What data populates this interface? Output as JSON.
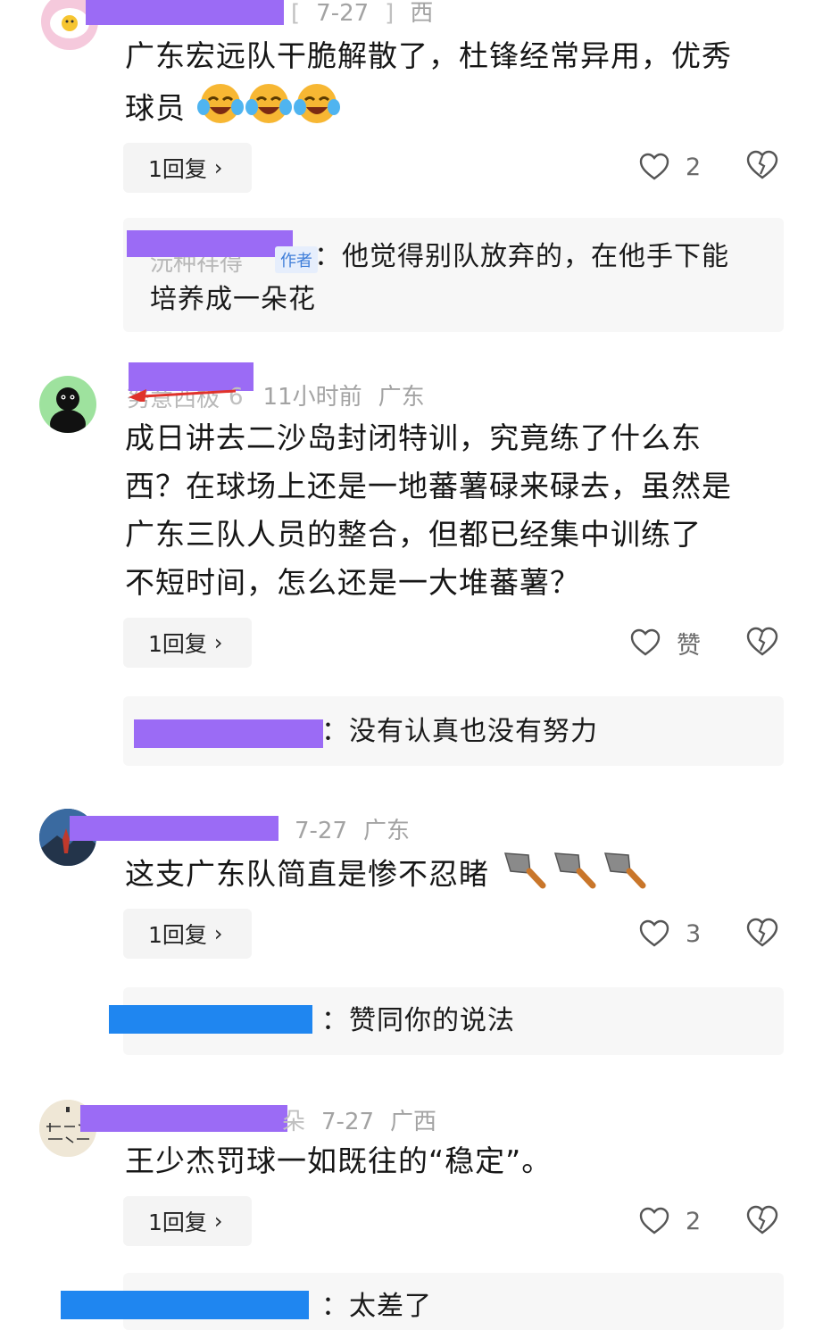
{
  "comments": [
    {
      "meta": {
        "date": "7-27",
        "region": "西"
      },
      "text_line1": "广东宏远队干脆解散了，杜锋经常异用，优秀",
      "text_line2": "球员",
      "emoji": [
        "laughing-crying-emoji",
        "laughing-crying-emoji",
        "laughing-crying-emoji"
      ],
      "reply_label": "1回复",
      "likes": "2",
      "sub_reply": {
        "author_tag": "作者",
        "text_line1": "：他觉得别队放弃的，在他手下能",
        "text_line2": "培养成一朵花"
      }
    },
    {
      "meta": {
        "name_tail": "6",
        "time": "11小时前",
        "region": "广东"
      },
      "text": [
        "成日讲去二沙岛封闭特训，究竟练了什么东",
        "西？在球场上还是一地蕃薯碌来碌去，虽然是",
        "广东三队人员的整合，但都已经集中训练了",
        "不短时间，怎么还是一大堆蕃薯？"
      ],
      "reply_label": "1回复",
      "likes": "赞",
      "sub_reply": {
        "text": "：没有认真也没有努力"
      }
    },
    {
      "meta": {
        "date": "7-27",
        "region": "广东"
      },
      "text": "这支广东队简直是惨不忍睹",
      "emoji": [
        "kitchen-knife-emoji",
        "kitchen-knife-emoji",
        "kitchen-knife-emoji"
      ],
      "reply_label": "1回复",
      "likes": "3",
      "sub_reply": {
        "text": "：赞同你的说法"
      }
    },
    {
      "meta": {
        "name_tail": "朵",
        "date": "7-27",
        "region": "广西"
      },
      "text": "王少杰罚球一如既往的“稳定”。",
      "reply_label": "1回复",
      "likes": "2",
      "sub_reply": {
        "text": "：太差了"
      }
    }
  ],
  "icons": {
    "like": "heart-outline-icon",
    "dislike": "broken-heart-icon",
    "chevron": "chevron-right-icon"
  },
  "colors": {
    "redaction_purple": "#9b6bf5",
    "redaction_blue": "#1f86f0",
    "meta_gray": "#a3a3a3",
    "arrow_red": "#e0322b"
  }
}
